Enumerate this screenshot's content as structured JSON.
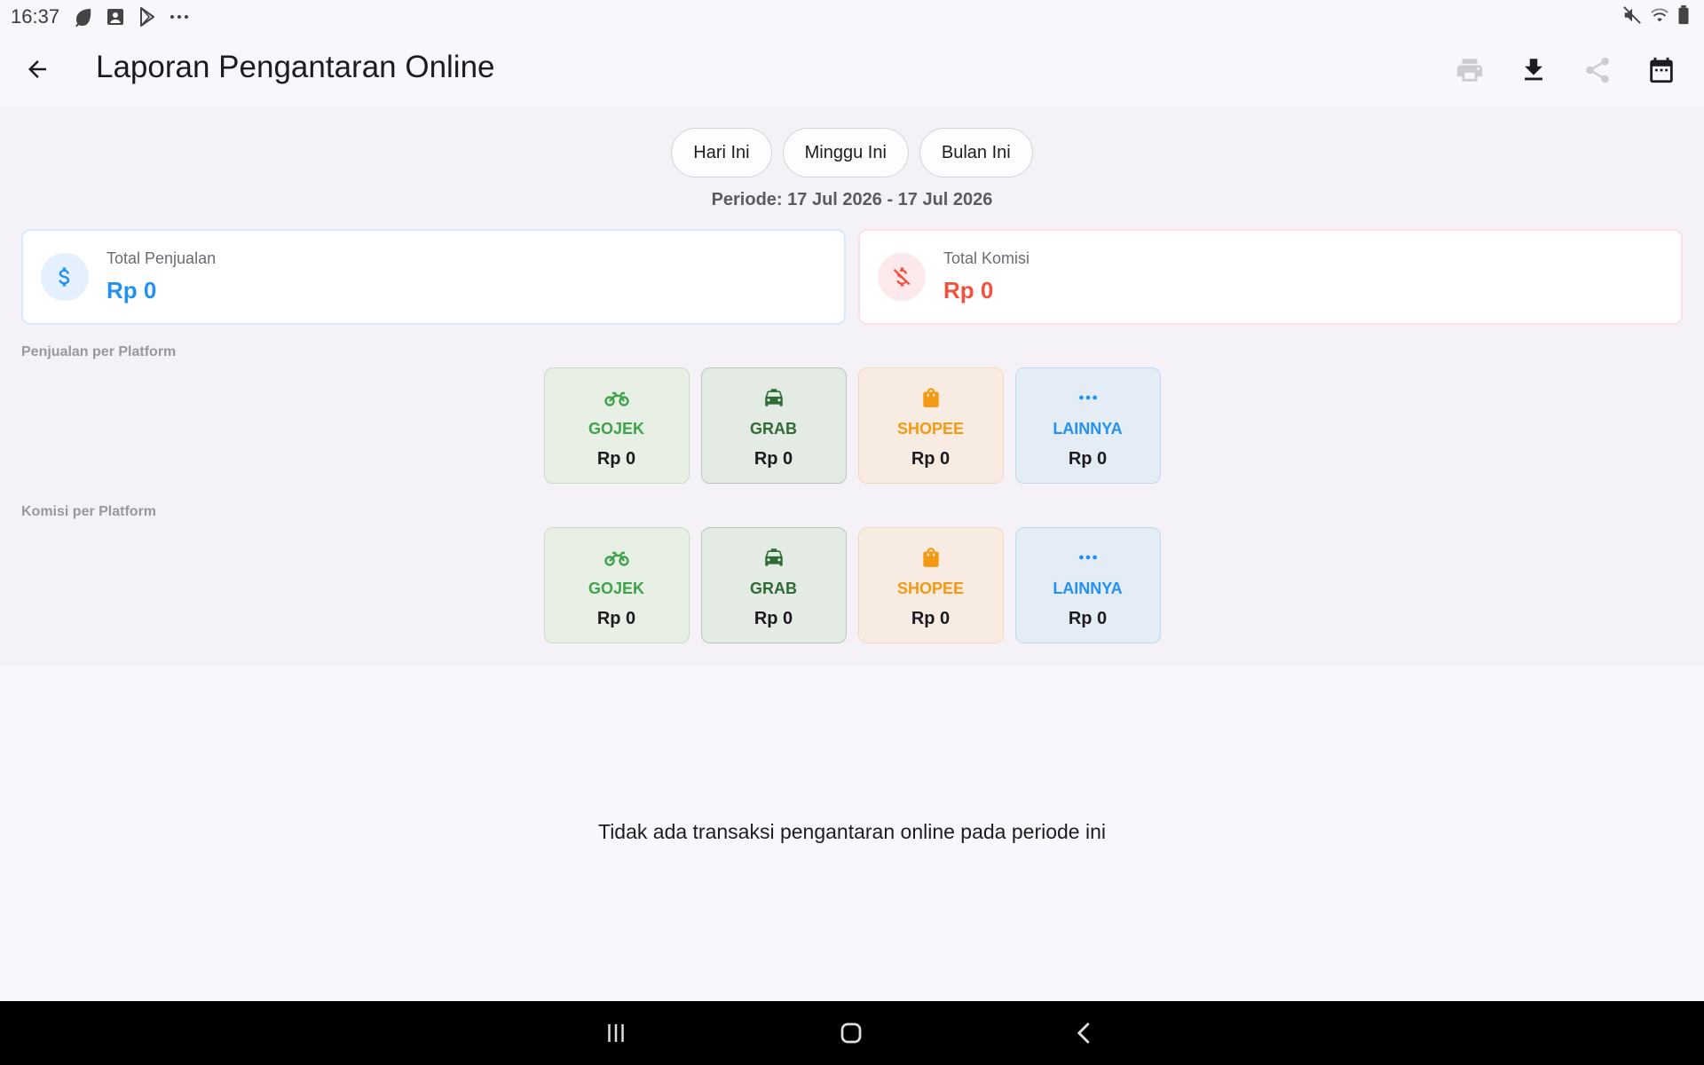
{
  "status_bar": {
    "time": "16:37",
    "left_icons": [
      "leaf-icon",
      "badge-icon",
      "play-store-icon",
      "more-dots-icon"
    ],
    "right_icons": [
      "mute-icon",
      "wifi-icon",
      "battery-icon"
    ]
  },
  "app_bar": {
    "title": "Laporan Pengantaran Online",
    "actions": [
      "print-icon",
      "download-icon",
      "share-icon",
      "calendar-icon"
    ]
  },
  "filters": {
    "chips": [
      "Hari Ini",
      "Minggu Ini",
      "Bulan Ini"
    ],
    "periode": "Periode: 17 Jul 2026 - 17 Jul 2026"
  },
  "summary": {
    "total_penjualan": {
      "label": "Total Penjualan",
      "value": "Rp 0",
      "color": "#2291f0"
    },
    "total_komisi": {
      "label": "Total Komisi",
      "value": "Rp 0",
      "color": "#f2513b"
    }
  },
  "penjualan_per_platform": {
    "label": "Penjualan per Platform",
    "items": [
      {
        "name": "GOJEK",
        "value": "Rp 0",
        "icon": "motorcycle-icon",
        "color": "#3ea34a"
      },
      {
        "name": "GRAB",
        "value": "Rp 0",
        "icon": "taxi-icon",
        "color": "#2e6b35"
      },
      {
        "name": "SHOPEE",
        "value": "Rp 0",
        "icon": "shopping-bag-icon",
        "color": "#f39a12"
      },
      {
        "name": "LAINNYA",
        "value": "Rp 0",
        "icon": "more-horiz-icon",
        "color": "#2291f0"
      }
    ]
  },
  "komisi_per_platform": {
    "label": "Komisi per Platform",
    "items": [
      {
        "name": "GOJEK",
        "value": "Rp 0",
        "icon": "motorcycle-icon",
        "color": "#3ea34a"
      },
      {
        "name": "GRAB",
        "value": "Rp 0",
        "icon": "taxi-icon",
        "color": "#2e6b35"
      },
      {
        "name": "SHOPEE",
        "value": "Rp 0",
        "icon": "shopping-bag-icon",
        "color": "#f39a12"
      },
      {
        "name": "LAINNYA",
        "value": "Rp 0",
        "icon": "more-horiz-icon",
        "color": "#2291f0"
      }
    ]
  },
  "empty_message": "Tidak ada transaksi pengantaran online pada periode ini",
  "nav_bar": [
    "recents-icon",
    "home-icon",
    "back-nav-icon"
  ]
}
